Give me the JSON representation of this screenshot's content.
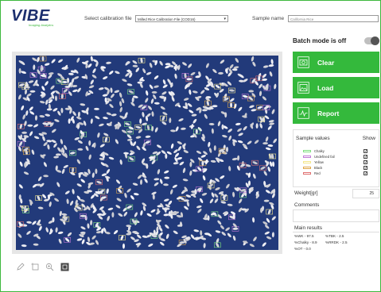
{
  "header": {
    "logo_text": "VIBE",
    "logo_tagline": "Imaging Analytics",
    "calibration_label": "Select calibration file",
    "calibration_value": "Milled Rice Calibration File (COD16)",
    "sample_name_label": "Sample name",
    "sample_name_value": "California Rice"
  },
  "batch": {
    "label": "Batch mode is off",
    "state": "off"
  },
  "buttons": [
    {
      "label": "Clear",
      "icon": "camera-icon"
    },
    {
      "label": "Load",
      "icon": "image-icon"
    },
    {
      "label": "Report",
      "icon": "chart-icon"
    }
  ],
  "sample_values": {
    "title": "Sample values",
    "show_label": "Show",
    "items": [
      {
        "label": "Chalky",
        "color": "#7fe07f",
        "checked": true
      },
      {
        "label": "Undefined fail",
        "color": "#c27ad8",
        "checked": true
      },
      {
        "label": "Yellow",
        "color": "#f4e78a",
        "checked": true
      },
      {
        "label": "Black",
        "color": "#e0a84a",
        "checked": true
      },
      {
        "label": "Red",
        "color": "#e07070",
        "checked": true
      }
    ]
  },
  "weight": {
    "label": "Weight[gr]",
    "value": "25"
  },
  "comments": {
    "label": "Comments",
    "value": ""
  },
  "main_results": {
    "title": "Main results",
    "items": [
      "%WK - 97.5",
      "%TBK - 2.5",
      "%Chalky - 8.9",
      "%RRDK - 2.5",
      "%OT - 0.0"
    ]
  },
  "toolbar": [
    "pencil-icon",
    "select-box-icon",
    "zoom-icon",
    "crop-icon"
  ],
  "colors": {
    "accent": "#34b93c",
    "tray": "#223a7a",
    "brand": "#1c2f6e"
  }
}
